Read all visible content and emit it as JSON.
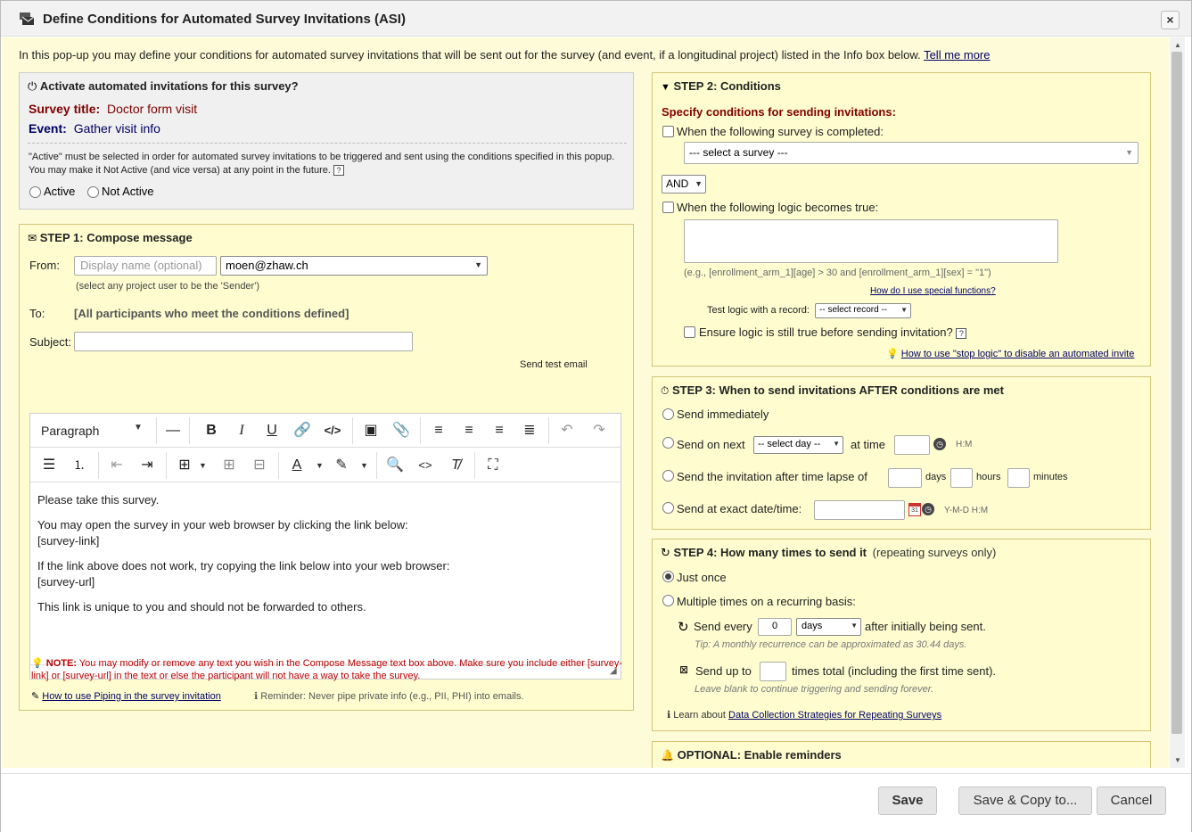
{
  "dialog": {
    "title": "Define Conditions for Automated Survey Invitations (ASI)",
    "close": "×"
  },
  "intro": {
    "text": "In this pop-up you may define your conditions for automated survey invitations that will be sent out for the survey (and event, if a longitudinal project) listed in the Info box below.",
    "link": "Tell me more"
  },
  "activate": {
    "heading": "Activate automated invitations for this survey?",
    "survey_title_label": "Survey title:",
    "survey_title_value": "Doctor form visit",
    "event_label": "Event:",
    "event_value": "Gather visit info",
    "note": "\"Active\" must be selected in order for automated survey invitations to be triggered and sent using the conditions specified in this popup. You may make it Not Active (and vice versa) at any point in the future.",
    "help": "?",
    "active_label": "Active",
    "not_active_label": "Not Active"
  },
  "step1": {
    "heading": "STEP 1: Compose message",
    "from_label": "From:",
    "display_name_placeholder": "Display name (optional)",
    "from_email": "moen@zhaw.ch",
    "sender_hint": "(select any project user to be the 'Sender')",
    "to_label": "To:",
    "to_value": "[All participants who meet the conditions defined]",
    "subject_label": "Subject:",
    "subject_value": "",
    "send_test": "Send test email",
    "paragraph_label": "Paragraph",
    "body": [
      "Please take this survey.",
      "You may open the survey in your web browser by clicking the link below:",
      "[survey-link]",
      "If the link above does not work, try copying the link below into your web browser:",
      "[survey-url]",
      "This link is unique to you and should not be forwarded to others."
    ],
    "note_label": "NOTE:",
    "note_text": "You may modify or remove any text you wish in the Compose Message text box above. Make sure you include either [survey-link] or [survey-url] in the text or else the participant will not have a way to take the survey.",
    "piping_link": "How to use Piping in the survey invitation",
    "reminder": "Reminder: Never pipe private info (e.g., PII, PHI) into emails."
  },
  "step2": {
    "heading": "STEP 2: Conditions",
    "specify": "Specify conditions for sending invitations:",
    "survey_completed_label": "When the following survey is completed:",
    "select_survey": "--- select a survey ---",
    "and_or": "AND",
    "logic_label": "When the following logic becomes true:",
    "logic_value": "",
    "example": "(e.g., [enrollment_arm_1][age] > 30 and [enrollment_arm_1][sex] = \"1\")",
    "special_functions": "How do I use special functions?",
    "test_logic_label": "Test logic with a record:",
    "select_record": "-- select record --",
    "ensure_label": "Ensure logic is still true before sending invitation?",
    "help": "?",
    "stop_logic_link": "How to use \"stop logic\" to disable an automated invite"
  },
  "step3": {
    "heading": "STEP 3: When to send invitations AFTER conditions are met",
    "send_immediately": "Send immediately",
    "send_on_next": "Send on next",
    "select_day": "-- select day --",
    "at_time": "at time",
    "hm": "H:M",
    "time_lapse": "Send the invitation after time lapse of",
    "days": "days",
    "hours": "hours",
    "minutes": "minutes",
    "exact": "Send at exact date/time:",
    "ymdhm": "Y-M-D H:M",
    "calendar_day": "31"
  },
  "step4": {
    "heading": "STEP 4: How many times to send it",
    "heading_suffix": "(repeating surveys only)",
    "just_once": "Just once",
    "multiple": "Multiple times on a recurring basis:",
    "send_every": "Send every",
    "every_value": "0",
    "every_unit": "days",
    "after_initial": "after initially being sent.",
    "tip": "Tip: A monthly recurrence can be approximated as 30.44 days.",
    "send_up_to": "Send up to",
    "times_total": "times total (including the first time sent).",
    "leave_blank": "Leave blank to continue triggering and sending forever.",
    "learn_about": "Learn about",
    "strategies_link": "Data Collection Strategies for Repeating Surveys"
  },
  "optional": {
    "heading": "OPTIONAL: Enable reminders"
  },
  "footer": {
    "save": "Save",
    "save_copy": "Save & Copy to...",
    "cancel": "Cancel"
  }
}
